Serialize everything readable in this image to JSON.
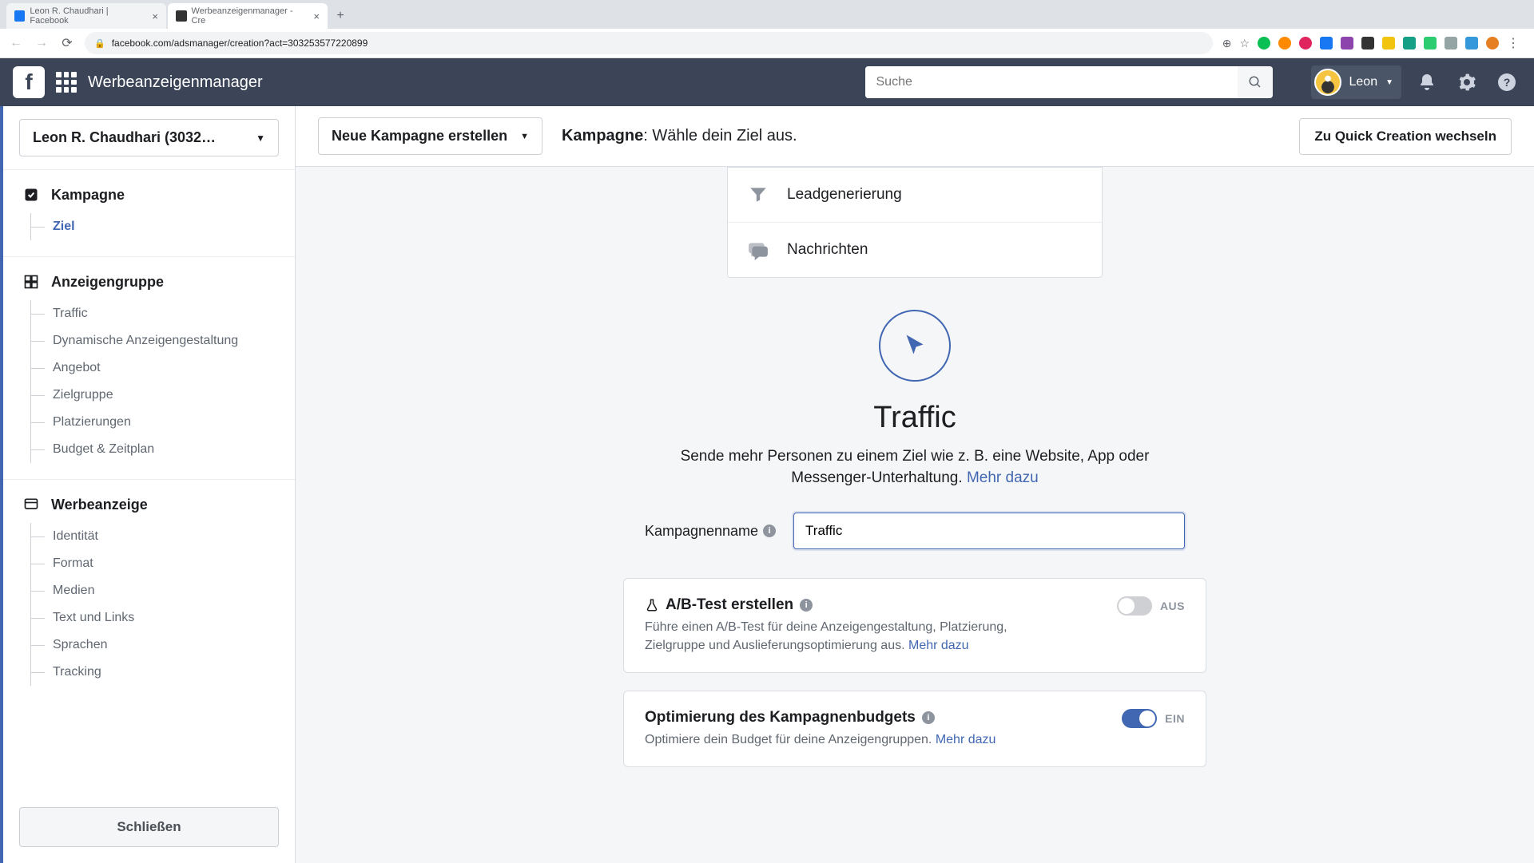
{
  "browser": {
    "tabs": [
      {
        "title": "Leon R. Chaudhari | Facebook",
        "active": false
      },
      {
        "title": "Werbeanzeigenmanager - Cre",
        "active": true
      }
    ],
    "url": "facebook.com/adsmanager/creation?act=303253577220899"
  },
  "topnav": {
    "app_title": "Werbeanzeigenmanager",
    "search_placeholder": "Suche",
    "user_name": "Leon"
  },
  "sidebar": {
    "account_select": "Leon R. Chaudhari (3032…",
    "group_campaign": {
      "title": "Kampagne",
      "items": [
        {
          "label": "Ziel",
          "active": true
        }
      ]
    },
    "group_adset": {
      "title": "Anzeigengruppe",
      "items": [
        {
          "label": "Traffic"
        },
        {
          "label": "Dynamische Anzeigengestaltung"
        },
        {
          "label": "Angebot"
        },
        {
          "label": "Zielgruppe"
        },
        {
          "label": "Platzierungen"
        },
        {
          "label": "Budget & Zeitplan"
        }
      ]
    },
    "group_ad": {
      "title": "Werbeanzeige",
      "items": [
        {
          "label": "Identität"
        },
        {
          "label": "Format"
        },
        {
          "label": "Medien"
        },
        {
          "label": "Text und Links"
        },
        {
          "label": "Sprachen"
        },
        {
          "label": "Tracking"
        }
      ]
    },
    "close_button": "Schließen"
  },
  "subheader": {
    "campaign_dropdown": "Neue Kampagne erstellen",
    "heading_bold": "Kampagne",
    "heading_rest": ": Wähle dein Ziel aus.",
    "quick_button": "Zu Quick Creation wechseln"
  },
  "objectives": [
    {
      "label": "Leadgenerierung",
      "icon": "funnel"
    },
    {
      "label": "Nachrichten",
      "icon": "chat"
    }
  ],
  "hero": {
    "title": "Traffic",
    "desc_part1": "Sende mehr Personen zu einem Ziel wie z. B. eine Website, App oder Messenger-Unterhaltung. ",
    "link": "Mehr dazu"
  },
  "campaign_name": {
    "label": "Kampagnenname",
    "value": "Traffic "
  },
  "ab_card": {
    "title": "A/B-Test erstellen",
    "desc": "Führe einen A/B-Test für deine Anzeigengestaltung, Platzierung, Zielgruppe und Auslieferungsoptimierung aus. ",
    "link": "Mehr dazu",
    "toggle_state": "off",
    "toggle_label": "AUS"
  },
  "budget_card": {
    "title": "Optimierung des Kampagnenbudgets",
    "desc": "Optimiere dein Budget für deine Anzeigengruppen. ",
    "link": "Mehr dazu",
    "toggle_state": "on",
    "toggle_label": "EIN"
  }
}
